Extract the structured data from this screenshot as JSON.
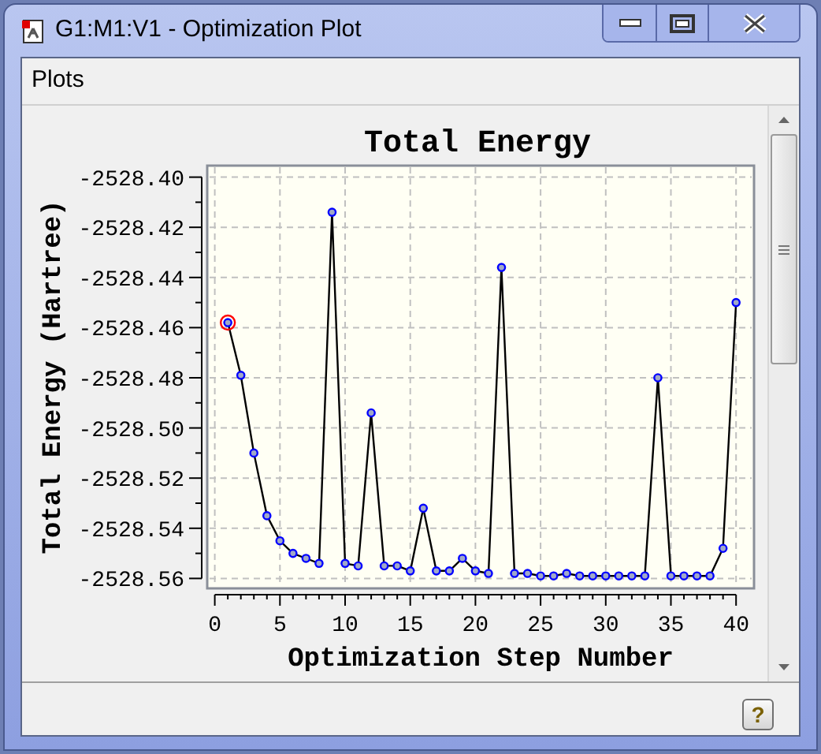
{
  "window": {
    "title": "G1:M1:V1 - Optimization Plot"
  },
  "menu": [
    {
      "label": "Plots"
    }
  ],
  "chart_data": {
    "type": "line",
    "title": "Total Energy",
    "xlabel": "Optimization Step Number",
    "ylabel": "Total Energy (Hartree)",
    "x": [
      1,
      2,
      3,
      4,
      5,
      6,
      7,
      8,
      9,
      10,
      11,
      12,
      13,
      14,
      15,
      16,
      17,
      18,
      19,
      20,
      21,
      22,
      23,
      24,
      25,
      26,
      27,
      28,
      29,
      30,
      31,
      32,
      33,
      34,
      35,
      36,
      37,
      38,
      39,
      40
    ],
    "grid": true,
    "series": [
      {
        "color": "#0000ff",
        "marker": "circle",
        "values": [
          -2528.458,
          -2528.479,
          -2528.51,
          -2528.535,
          -2528.545,
          -2528.55,
          -2528.552,
          -2528.554,
          -2528.414,
          -2528.554,
          -2528.555,
          -2528.494,
          -2528.555,
          -2528.555,
          -2528.557,
          -2528.532,
          -2528.557,
          -2528.557,
          -2528.552,
          -2528.557,
          -2528.558,
          -2528.436,
          -2528.558,
          -2528.558,
          -2528.559,
          -2528.559,
          -2528.558,
          -2528.559,
          -2528.559,
          -2528.559,
          -2528.559,
          -2528.559,
          -2528.559,
          -2528.48,
          -2528.559,
          -2528.559,
          -2528.559,
          -2528.559,
          -2528.548,
          -2528.45
        ]
      }
    ],
    "xlim": [
      0,
      40
    ],
    "ylim": [
      -2528.56,
      -2528.4
    ],
    "xticks": [
      0,
      5,
      10,
      15,
      20,
      25,
      30,
      35,
      40
    ],
    "yticks": [
      {
        "value": -2528.4,
        "label": "-2528.40"
      },
      {
        "value": -2528.42,
        "label": "-2528.42"
      },
      {
        "value": -2528.44,
        "label": "-2528.44"
      },
      {
        "value": -2528.46,
        "label": "-2528.46"
      },
      {
        "value": -2528.48,
        "label": "-2528.48"
      },
      {
        "value": -2528.5,
        "label": "-2528.50"
      },
      {
        "value": -2528.52,
        "label": "-2528.52"
      },
      {
        "value": -2528.54,
        "label": "-2528.54"
      },
      {
        "value": -2528.56,
        "label": "-2528.56"
      }
    ]
  },
  "status_bar": {
    "help_button": "?"
  }
}
